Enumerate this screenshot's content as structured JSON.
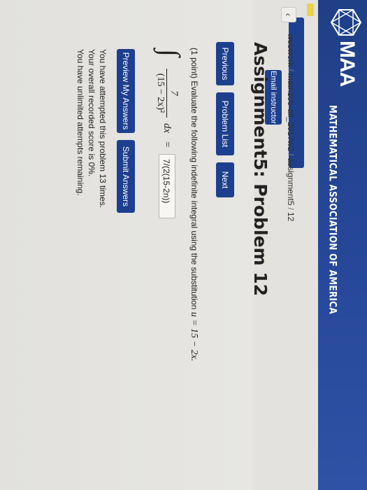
{
  "header": {
    "logo_text": "MAA",
    "org_name": "MATHEMATICAL ASSOCIATION OF AMERICA",
    "color": "#27489a"
  },
  "sidebar": {
    "email_label": "Email instructor"
  },
  "breadcrumb": {
    "back_glyph": "‹",
    "parts": [
      "webwork",
      "math105-all_2017w2",
      "assignment5",
      "12"
    ],
    "separator": "/"
  },
  "page_title": "Assignment5: Problem 12",
  "nav": {
    "previous": "Previous",
    "problem_list": "Problem List",
    "next": "Next"
  },
  "problem": {
    "prompt": "(1 point) Evaluate the following indefinite integral using the substitution",
    "substitution": "u = 15 − 2x.",
    "integral_sign": "∫",
    "numerator": "7",
    "denominator": "(15 − 2x)²",
    "differential": "dx",
    "equals": "=",
    "answer_value": "7/(2(15-2n))"
  },
  "actions": {
    "preview": "Preview My Answers",
    "submit": "Submit Answers"
  },
  "status": {
    "attempts": "You have attempted this problem 13 times.",
    "score": "Your overall recorded score is 0%.",
    "remaining": "You have unlimited attempts remaining."
  }
}
